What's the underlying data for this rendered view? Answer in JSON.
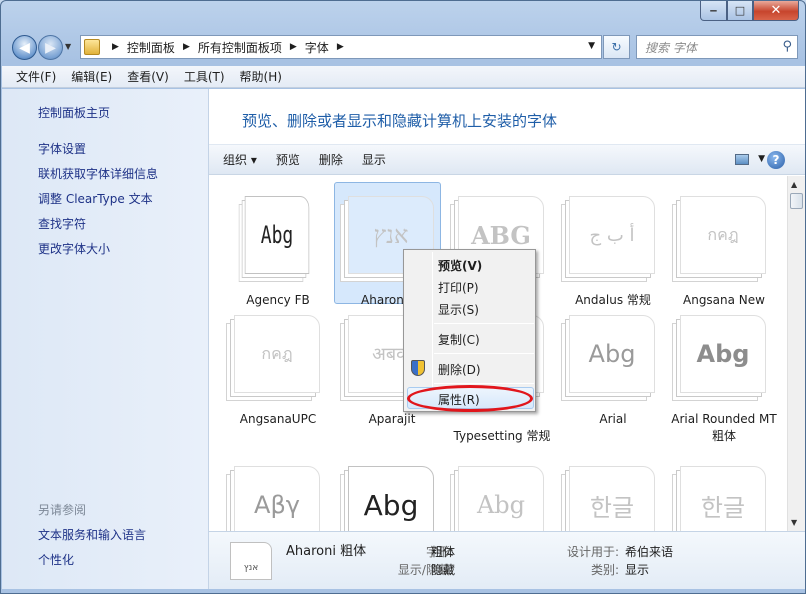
{
  "window": {
    "minimize": "‒",
    "maximize": "□",
    "close": "✕"
  },
  "address": {
    "crumbs": [
      "控制面板",
      "所有控制面板项",
      "字体"
    ],
    "search_placeholder": "搜索 字体"
  },
  "menubar": [
    "文件(F)",
    "编辑(E)",
    "查看(V)",
    "工具(T)",
    "帮助(H)"
  ],
  "sidebar": {
    "links": [
      "控制面板主页",
      "字体设置",
      "联机获取字体详细信息",
      "调整 ClearType 文本",
      "查找字符",
      "更改字体大小"
    ],
    "see_also": "另请参阅",
    "see_also_links": [
      "文本服务和输入语言",
      "个性化"
    ]
  },
  "heading": "预览、删除或者显示和隐藏计算机上安装的字体",
  "toolbar": {
    "organize": "组织 ▾",
    "preview": "预览",
    "delete": "删除",
    "show": "显示"
  },
  "fonts": [
    {
      "sample": "Abg",
      "name": "Agency FB",
      "faded": false
    },
    {
      "sample": "אנץ",
      "name": "Aharoni 粗",
      "faded": true,
      "selected": true
    },
    {
      "sample": "ABG",
      "name": "",
      "faded": true
    },
    {
      "sample": "أ ب ج",
      "name": "Andalus 常规",
      "faded": true
    },
    {
      "sample": "กคฎ",
      "name": "Angsana New",
      "faded": true
    },
    {
      "sample": "กคฎ",
      "name": "AngsanaUPC",
      "faded": true
    },
    {
      "sample": "अबक",
      "name": "Aparajit",
      "faded": true
    },
    {
      "sample": "",
      "name": "Typesetting 常规",
      "faded": true
    },
    {
      "sample": "Abg",
      "name": "Arial",
      "faded": true
    },
    {
      "sample": "Abg",
      "name": "Arial Rounded MT 粗体",
      "faded": false
    },
    {
      "sample": "Αβγ",
      "name": "",
      "faded": true
    },
    {
      "sample": "Abg",
      "name": "",
      "faded": false
    },
    {
      "sample": "Abg",
      "name": "",
      "faded": true
    },
    {
      "sample": "한글",
      "name": "",
      "faded": true
    },
    {
      "sample": "한글",
      "name": "",
      "faded": true
    }
  ],
  "context_menu": [
    "预览(V)",
    "打印(P)",
    "显示(S)",
    "复制(C)",
    "删除(D)",
    "属性(R)"
  ],
  "details": {
    "thumb": "אנץ",
    "name": "Aharoni 粗体",
    "style_label": "字形:",
    "style": "粗体",
    "showhide_label": "显示/隐藏:",
    "showhide": "隐藏",
    "designed_label": "设计用于:",
    "designed": "希伯来语",
    "category_label": "类别:",
    "category": "显示"
  }
}
